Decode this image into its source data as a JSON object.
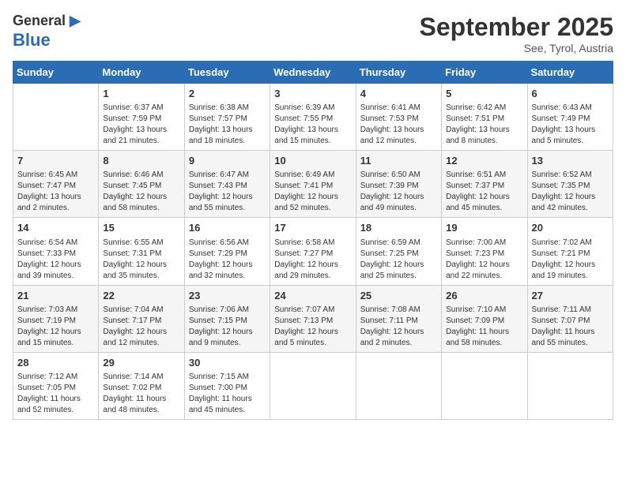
{
  "header": {
    "logo_line1": "General",
    "logo_line2": "Blue",
    "month": "September 2025",
    "location": "See, Tyrol, Austria"
  },
  "days_of_week": [
    "Sunday",
    "Monday",
    "Tuesday",
    "Wednesday",
    "Thursday",
    "Friday",
    "Saturday"
  ],
  "weeks": [
    [
      {
        "day": "",
        "info": ""
      },
      {
        "day": "1",
        "info": "Sunrise: 6:37 AM\nSunset: 7:59 PM\nDaylight: 13 hours\nand 21 minutes."
      },
      {
        "day": "2",
        "info": "Sunrise: 6:38 AM\nSunset: 7:57 PM\nDaylight: 13 hours\nand 18 minutes."
      },
      {
        "day": "3",
        "info": "Sunrise: 6:39 AM\nSunset: 7:55 PM\nDaylight: 13 hours\nand 15 minutes."
      },
      {
        "day": "4",
        "info": "Sunrise: 6:41 AM\nSunset: 7:53 PM\nDaylight: 13 hours\nand 12 minutes."
      },
      {
        "day": "5",
        "info": "Sunrise: 6:42 AM\nSunset: 7:51 PM\nDaylight: 13 hours\nand 8 minutes."
      },
      {
        "day": "6",
        "info": "Sunrise: 6:43 AM\nSunset: 7:49 PM\nDaylight: 13 hours\nand 5 minutes."
      }
    ],
    [
      {
        "day": "7",
        "info": "Sunrise: 6:45 AM\nSunset: 7:47 PM\nDaylight: 13 hours\nand 2 minutes."
      },
      {
        "day": "8",
        "info": "Sunrise: 6:46 AM\nSunset: 7:45 PM\nDaylight: 12 hours\nand 58 minutes."
      },
      {
        "day": "9",
        "info": "Sunrise: 6:47 AM\nSunset: 7:43 PM\nDaylight: 12 hours\nand 55 minutes."
      },
      {
        "day": "10",
        "info": "Sunrise: 6:49 AM\nSunset: 7:41 PM\nDaylight: 12 hours\nand 52 minutes."
      },
      {
        "day": "11",
        "info": "Sunrise: 6:50 AM\nSunset: 7:39 PM\nDaylight: 12 hours\nand 49 minutes."
      },
      {
        "day": "12",
        "info": "Sunrise: 6:51 AM\nSunset: 7:37 PM\nDaylight: 12 hours\nand 45 minutes."
      },
      {
        "day": "13",
        "info": "Sunrise: 6:52 AM\nSunset: 7:35 PM\nDaylight: 12 hours\nand 42 minutes."
      }
    ],
    [
      {
        "day": "14",
        "info": "Sunrise: 6:54 AM\nSunset: 7:33 PM\nDaylight: 12 hours\nand 39 minutes."
      },
      {
        "day": "15",
        "info": "Sunrise: 6:55 AM\nSunset: 7:31 PM\nDaylight: 12 hours\nand 35 minutes."
      },
      {
        "day": "16",
        "info": "Sunrise: 6:56 AM\nSunset: 7:29 PM\nDaylight: 12 hours\nand 32 minutes."
      },
      {
        "day": "17",
        "info": "Sunrise: 6:58 AM\nSunset: 7:27 PM\nDaylight: 12 hours\nand 29 minutes."
      },
      {
        "day": "18",
        "info": "Sunrise: 6:59 AM\nSunset: 7:25 PM\nDaylight: 12 hours\nand 25 minutes."
      },
      {
        "day": "19",
        "info": "Sunrise: 7:00 AM\nSunset: 7:23 PM\nDaylight: 12 hours\nand 22 minutes."
      },
      {
        "day": "20",
        "info": "Sunrise: 7:02 AM\nSunset: 7:21 PM\nDaylight: 12 hours\nand 19 minutes."
      }
    ],
    [
      {
        "day": "21",
        "info": "Sunrise: 7:03 AM\nSunset: 7:19 PM\nDaylight: 12 hours\nand 15 minutes."
      },
      {
        "day": "22",
        "info": "Sunrise: 7:04 AM\nSunset: 7:17 PM\nDaylight: 12 hours\nand 12 minutes."
      },
      {
        "day": "23",
        "info": "Sunrise: 7:06 AM\nSunset: 7:15 PM\nDaylight: 12 hours\nand 9 minutes."
      },
      {
        "day": "24",
        "info": "Sunrise: 7:07 AM\nSunset: 7:13 PM\nDaylight: 12 hours\nand 5 minutes."
      },
      {
        "day": "25",
        "info": "Sunrise: 7:08 AM\nSunset: 7:11 PM\nDaylight: 12 hours\nand 2 minutes."
      },
      {
        "day": "26",
        "info": "Sunrise: 7:10 AM\nSunset: 7:09 PM\nDaylight: 11 hours\nand 58 minutes."
      },
      {
        "day": "27",
        "info": "Sunrise: 7:11 AM\nSunset: 7:07 PM\nDaylight: 11 hours\nand 55 minutes."
      }
    ],
    [
      {
        "day": "28",
        "info": "Sunrise: 7:12 AM\nSunset: 7:05 PM\nDaylight: 11 hours\nand 52 minutes."
      },
      {
        "day": "29",
        "info": "Sunrise: 7:14 AM\nSunset: 7:02 PM\nDaylight: 11 hours\nand 48 minutes."
      },
      {
        "day": "30",
        "info": "Sunrise: 7:15 AM\nSunset: 7:00 PM\nDaylight: 11 hours\nand 45 minutes."
      },
      {
        "day": "",
        "info": ""
      },
      {
        "day": "",
        "info": ""
      },
      {
        "day": "",
        "info": ""
      },
      {
        "day": "",
        "info": ""
      }
    ]
  ]
}
